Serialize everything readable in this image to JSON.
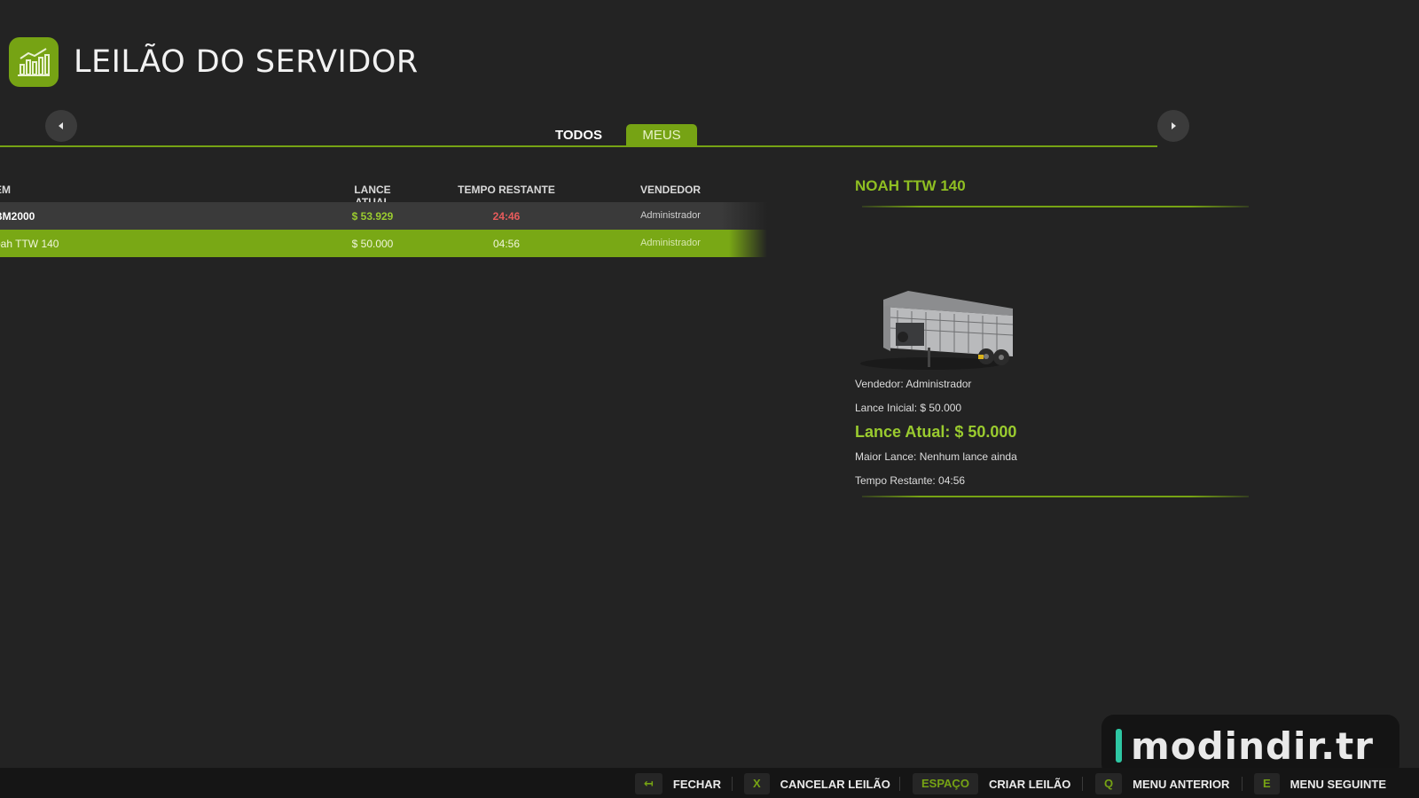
{
  "header": {
    "title": "LEILÃO DO SERVIDOR",
    "icon": "chart-bars-icon"
  },
  "nav": {
    "prev_icon": "triangle-left-icon",
    "next_icon": "triangle-right-icon"
  },
  "tabs": [
    {
      "label": "TODOS",
      "active": false
    },
    {
      "label": "MEUS",
      "active": true
    }
  ],
  "table": {
    "columns": [
      "EM",
      "LANCE ATUAL",
      "TEMPO RESTANTE",
      "VENDEDOR"
    ],
    "rows": [
      {
        "item": "BM2000",
        "bid": "$ 53.929",
        "time": "24:46",
        "seller": "Administrador",
        "selected": false
      },
      {
        "item": "oah TTW 140",
        "bid": "$ 50.000",
        "time": "04:56",
        "seller": "Administrador",
        "selected": true
      }
    ]
  },
  "detail": {
    "title": "NOAH TTW 140",
    "image": "livestock-trailer-image",
    "seller": "Vendedor: Administrador",
    "starting_bid": "Lance Inicial: $ 50.000",
    "current_bid": "Lance Atual: $ 50.000",
    "highest_bid": "Maior Lance: Nenhum lance ainda",
    "time_left": "Tempo Restante: 04:56"
  },
  "footer": {
    "hints": [
      {
        "key": "↤",
        "label": "FECHAR"
      },
      {
        "key": "X",
        "label": "CANCELAR LEILÃO"
      },
      {
        "key": "ESPAÇO",
        "label": "CRIAR LEILÃO"
      },
      {
        "key": "Q",
        "label": "MENU ANTERIOR"
      },
      {
        "key": "E",
        "label": "MENU SEGUINTE"
      }
    ]
  },
  "watermark": {
    "text": "modindir.tr"
  },
  "colors": {
    "accent": "#76a314",
    "background": "#232323",
    "time_warning": "#e85b5b"
  }
}
